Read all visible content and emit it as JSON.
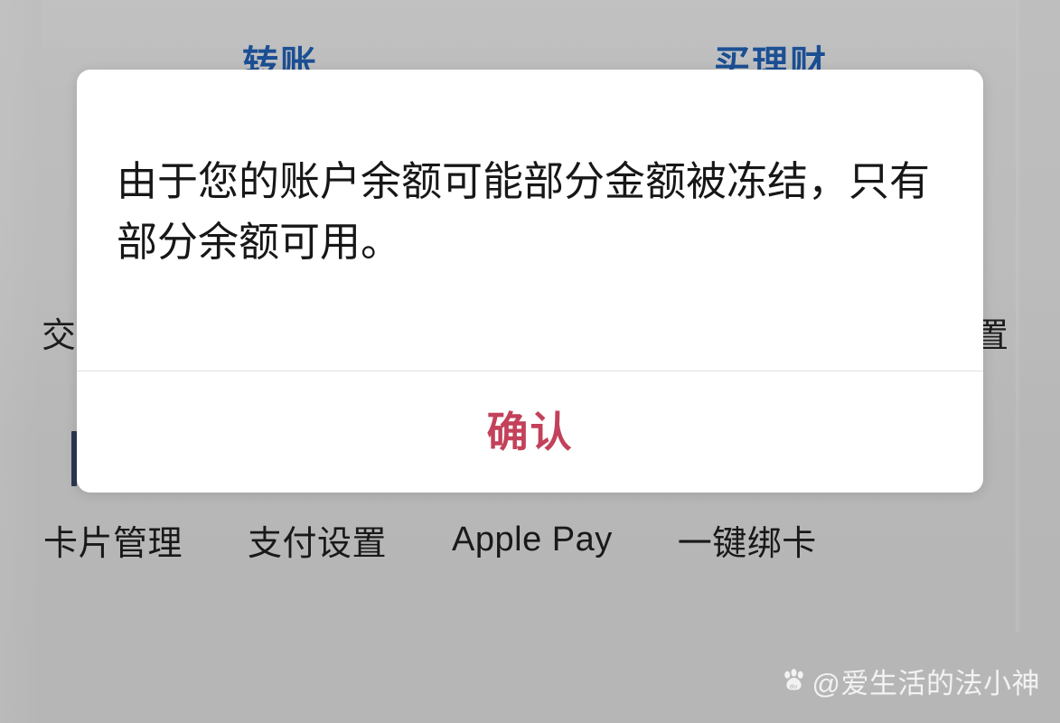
{
  "background_app": {
    "quick_actions": [
      {
        "label": "转账",
        "color": "#1c4f93"
      },
      {
        "label": "买理财",
        "color": "#1c4f93"
      }
    ],
    "row_labels": {
      "left": "交",
      "right": "置"
    },
    "bottom_nav": [
      {
        "label": "卡片管理"
      },
      {
        "label": "支付设置"
      },
      {
        "label": "Apple Pay"
      },
      {
        "label": "一键绑卡"
      }
    ]
  },
  "dialog": {
    "message": "由于您的账户余额可能部分金额被冻结，只有部分余额可用。",
    "confirm_label": "确认",
    "confirm_color": "#c3415a",
    "background_color": "#ffffff",
    "divider_color": "#e0e0e2"
  },
  "watermark": {
    "icon": "baidu-paw-icon",
    "text": "@爱生活的法小神"
  },
  "canvas": {
    "background_color": "#b9b9b9",
    "width": "1173",
    "height": "800"
  }
}
